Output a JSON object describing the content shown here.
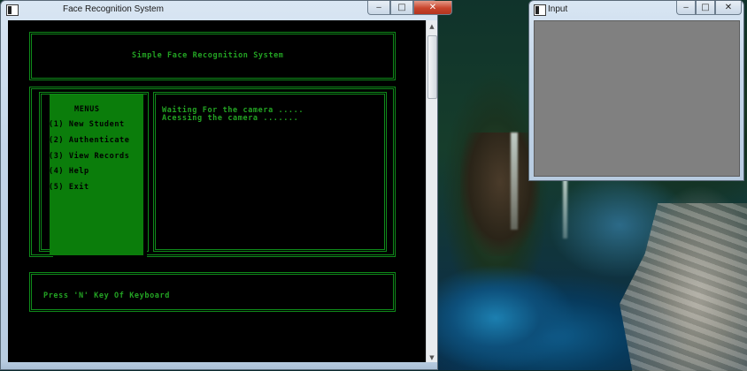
{
  "face_window": {
    "title": "Face Recognition System",
    "header_title": "Simple Face Recognition System",
    "menu": {
      "title": "MENUS",
      "items": [
        "(1) New Student",
        "(2) Authenticate",
        "(3) View Records",
        "(4) Help",
        "(5) Exit"
      ]
    },
    "status_lines": [
      "Waiting For the camera .....",
      "Acessing the camera ......."
    ],
    "prompt": "Press 'N' Key Of Keyboard"
  },
  "input_window": {
    "title": "Input"
  },
  "caption_buttons": {
    "minimize": "‒",
    "maximize": "□",
    "close": "✕"
  },
  "colors": {
    "console_bg": "#000000",
    "console_green": "#0f8a1a",
    "menu_green": "#0b7d0b",
    "input_canvas": "#808080"
  },
  "icons": [
    "console-app-icon",
    "minimize-icon",
    "maximize-icon",
    "close-icon",
    "scroll-up-icon",
    "scroll-down-icon"
  ]
}
